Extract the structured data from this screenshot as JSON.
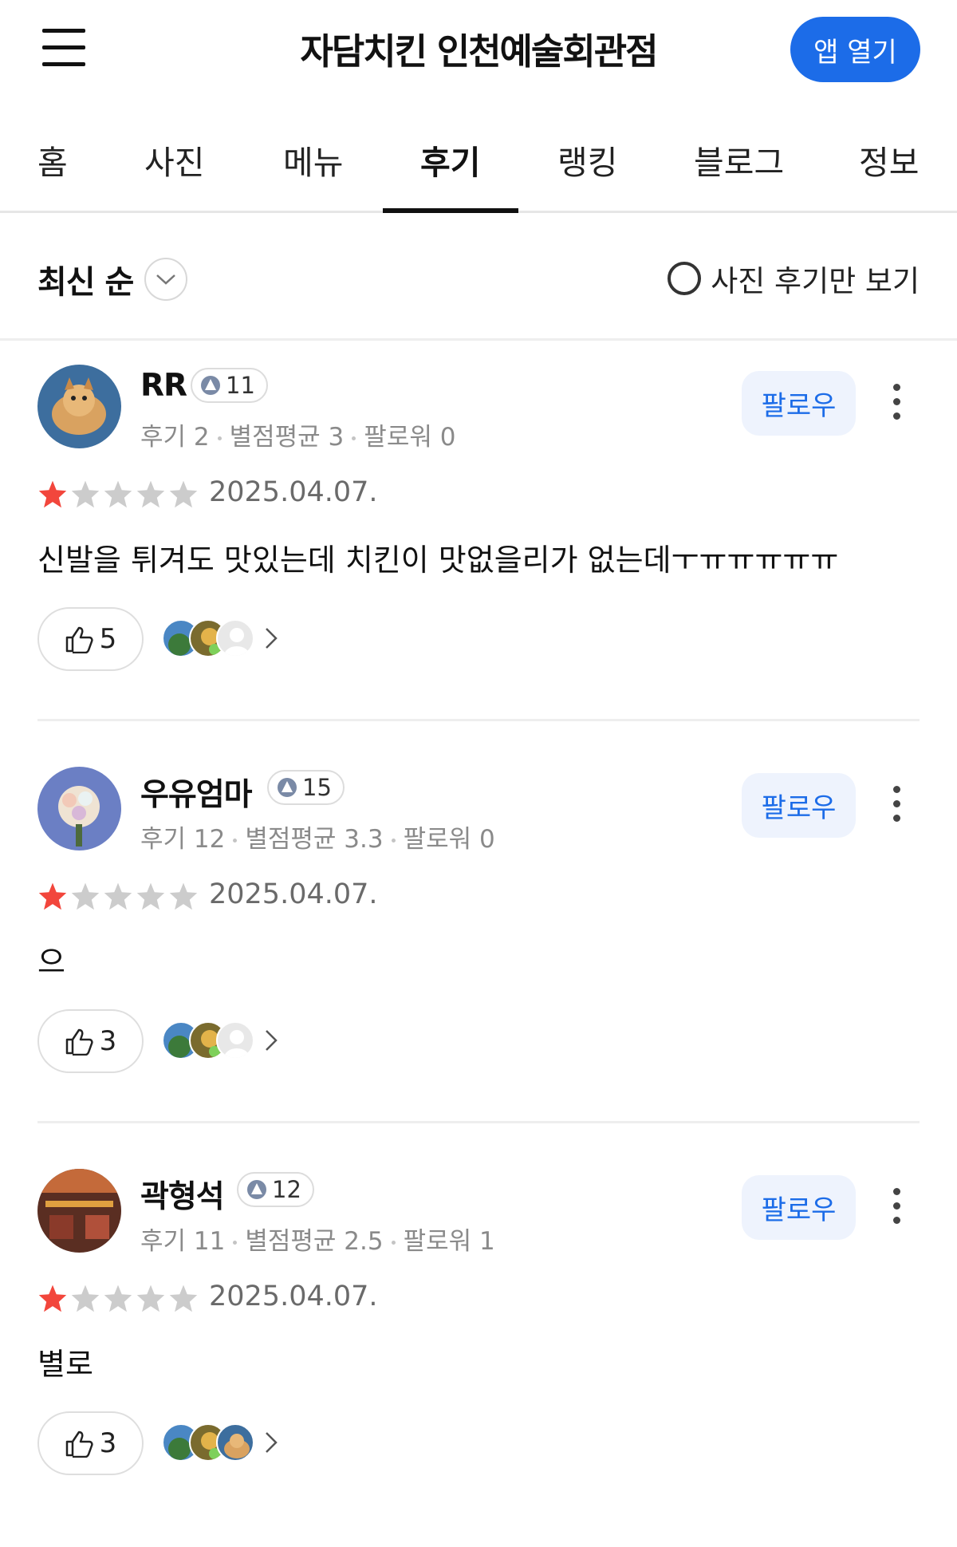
{
  "header": {
    "title": "자담치킨 인천예술회관점",
    "app_button": "앱 열기",
    "menu_icon": "hamburger-icon"
  },
  "tabs": [
    {
      "label": "홈",
      "active": false
    },
    {
      "label": "사진",
      "active": false
    },
    {
      "label": "메뉴",
      "active": false
    },
    {
      "label": "후기",
      "active": true
    },
    {
      "label": "랭킹",
      "active": false
    },
    {
      "label": "블로그",
      "active": false
    },
    {
      "label": "정보",
      "active": false
    }
  ],
  "sort": {
    "label": "최신 순",
    "photo_only_label": "사진 후기만 보기"
  },
  "colors": {
    "accent": "#1c6ce8",
    "star_on": "#f2463c",
    "star_off": "#cccccc"
  },
  "reviews": [
    {
      "name": "RR",
      "level": "11",
      "stats": {
        "reviews": "후기 2",
        "avg": "별점평균 3",
        "followers": "팔로워 0"
      },
      "follow": "팔로우",
      "rating": 1,
      "date": "2025.04.07.",
      "text": "신발을 튀겨도 맛있는데 치킨이 맛없을리가 없는데ㅜㅠㅠㅠㅠㅠ",
      "likes": "5"
    },
    {
      "name": "우유엄마",
      "level": "15",
      "stats": {
        "reviews": "후기 12",
        "avg": "별점평균 3.3",
        "followers": "팔로워 0"
      },
      "follow": "팔로우",
      "rating": 1,
      "date": "2025.04.07.",
      "text": "으",
      "likes": "3"
    },
    {
      "name": "곽형석",
      "level": "12",
      "stats": {
        "reviews": "후기 11",
        "avg": "별점평균 2.5",
        "followers": "팔로워 1"
      },
      "follow": "팔로우",
      "rating": 1,
      "date": "2025.04.07.",
      "text": "별로",
      "likes": "3"
    }
  ]
}
